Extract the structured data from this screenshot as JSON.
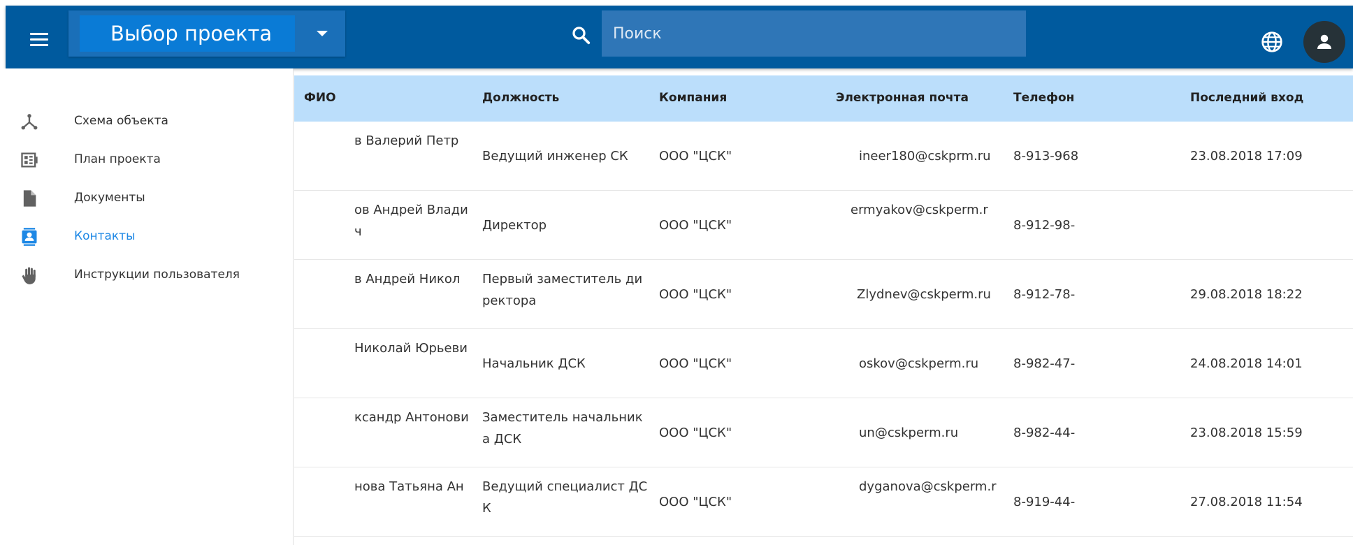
{
  "header": {
    "project_title": "Выбор проекта",
    "search_placeholder": "Поиск",
    "icons": [
      "menu-icon",
      "caret-down-icon",
      "search-icon",
      "globe-icon",
      "account-icon"
    ],
    "colors": {
      "appbar": "#005a9e",
      "active": "#1e88e5",
      "table_header": "#bbdefb"
    }
  },
  "sidebar": {
    "items": [
      {
        "label": "Схема объекта",
        "icon": "schema-icon",
        "active": false
      },
      {
        "label": "План проекта",
        "icon": "plan-icon",
        "active": false
      },
      {
        "label": "Документы",
        "icon": "document-icon",
        "active": false
      },
      {
        "label": "Контакты",
        "icon": "contacts-icon",
        "active": true
      },
      {
        "label": "Инструкции пользователя",
        "icon": "hand-icon",
        "active": false
      }
    ]
  },
  "table": {
    "columns": [
      "ФИО",
      "Должность",
      "Компания",
      "Электронная почта",
      "Телефон",
      "Последний вход"
    ],
    "rows": [
      {
        "fio": "в Валерий Петр",
        "position": "Ведущий инженер СК",
        "company": "ООО \"ЦСК\"",
        "email": "ineer180@cskprm.ru",
        "phone": "8-913-968",
        "last_login": "23.08.2018 17:09"
      },
      {
        "fio": "ов Андрей Влади",
        "fio_tail": "ч",
        "position": "Директор",
        "company": "ООО \"ЦСК\"",
        "email": "ermyakov@cskperm.r",
        "phone": "8-912-98-",
        "last_login": ""
      },
      {
        "fio": "в Андрей Никол",
        "position": "Первый заместитель ди",
        "position_tail": "ректора",
        "company": "ООО \"ЦСК\"",
        "email": "Zlydnev@cskperm.ru",
        "phone": "8-912-78-",
        "last_login": "29.08.2018 18:22"
      },
      {
        "fio": "Николай Юрьеви",
        "position": "Начальник ДСК",
        "company": "ООО \"ЦСК\"",
        "email": "oskov@cskperm.ru",
        "phone": "8-982-47-",
        "last_login": "24.08.2018 14:01"
      },
      {
        "fio": "ксандр Антонови",
        "position": "Заместитель начальник",
        "position_tail": "а ДСК",
        "company": "ООО \"ЦСК\"",
        "email": "un@cskperm.ru",
        "phone": "8-982-44-",
        "last_login": "23.08.2018 15:59"
      },
      {
        "fio": "нова Татьяна Ан",
        "position": "Ведущий специалист ДС",
        "position_tail": "К",
        "company": "ООО \"ЦСК\"",
        "email": "dyganova@cskperm.r",
        "phone": "8-919-44-",
        "last_login": "27.08.2018 11:54"
      }
    ]
  }
}
